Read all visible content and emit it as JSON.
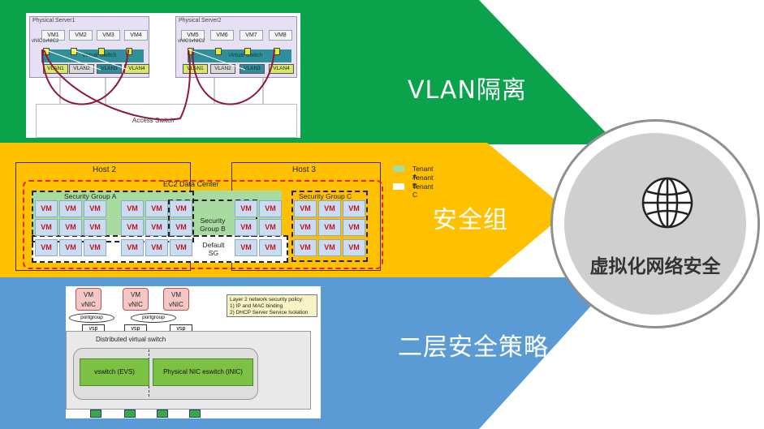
{
  "bands": {
    "vlan_label": "VLAN隔离",
    "sg_label": "安全组",
    "l2_label": "二层安全策略",
    "colors": {
      "green": "#0aa24b",
      "yellow": "#ffc000",
      "blue": "#5b9bd5"
    }
  },
  "center": {
    "title": "虚拟化网络安全",
    "icon": "globe-icon"
  },
  "panel_vlan": {
    "server1": "Physical Server1",
    "server2": "Physical Server2",
    "vms1": [
      "VM1",
      "VM2",
      "VM3",
      "VM4"
    ],
    "vms2": [
      "VM5",
      "VM6",
      "VM7",
      "VM8"
    ],
    "vnic": "vNIC1vNIC2",
    "vswitch": "Virtual Switch",
    "vlans": [
      "VLAN1",
      "VLAN2",
      "VLAN3",
      "VLAN4"
    ],
    "access_switch": "Access Switch"
  },
  "panel_sg": {
    "host2": "Host 2",
    "host3": "Host 3",
    "datacenter": "EC2 Data Center",
    "sg_a": "Security Group A",
    "sg_b": "Security Group B",
    "sg_c": "Security Group C",
    "sg_default": "Default SG",
    "vm": "VM",
    "legend": [
      {
        "label": "Tenant A",
        "color": "#a8dba0"
      },
      {
        "label": "Tenant B",
        "color": "#ffc000"
      },
      {
        "label": "Tenant C",
        "color": "#ffffff"
      }
    ]
  },
  "panel_l2": {
    "vm_label": "VM",
    "vnic_label": "vNIC",
    "portgroup": "portgroup",
    "vsp": "vsp",
    "policy_title": "Layer 2 network security policy:",
    "policy_1": "1) IP and MAC binding",
    "policy_2": "2) DHCP Server Service Isolation",
    "dvs": "Distributed virtual switch",
    "evs": "vswitch (EVS)",
    "nic": "Physical NIC eswitch (iNIC)"
  }
}
